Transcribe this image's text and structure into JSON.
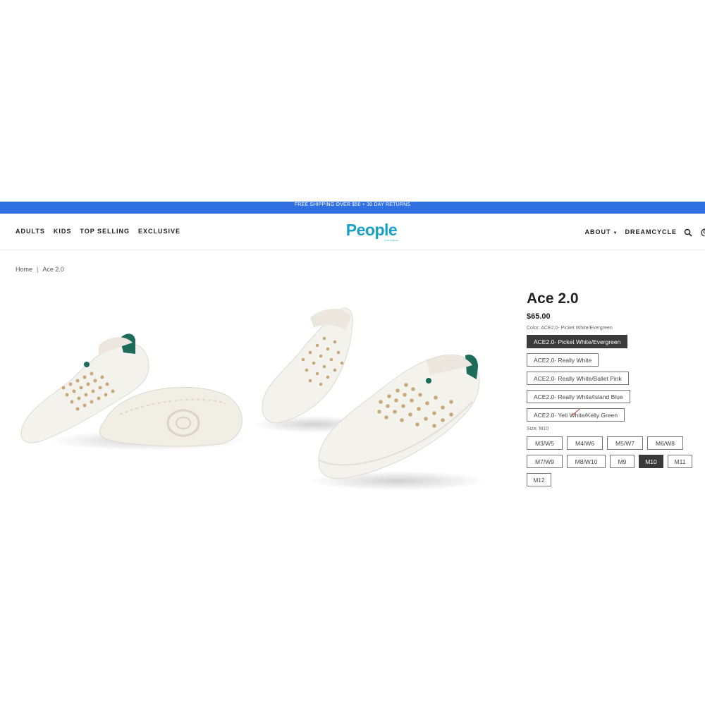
{
  "promo": "FREE SHIPPING OVER $50 + 30 DAY RETURNS",
  "nav": {
    "left": [
      "ADULTS",
      "KIDS",
      "TOP SELLING",
      "EXCLUSIVE"
    ],
    "right": [
      "ABOUT",
      "DREAMCYCLE"
    ]
  },
  "logo": {
    "word": "People",
    "sub": "FOOTWEAR"
  },
  "breadcrumb": {
    "home": "Home",
    "separator": "|",
    "current": "Ace 2.0"
  },
  "product": {
    "title": "Ace 2.0",
    "price": "$65.00",
    "color_label": "Color: ACE2.0- Picket White/Evergreen",
    "colors": [
      {
        "label": "ACE2.0- Picket White/Evergreen",
        "selected": true
      },
      {
        "label": "ACE2.0- Really White",
        "selected": false
      },
      {
        "label": "ACE2.0- Really White/Ballet Pink",
        "selected": false
      },
      {
        "label": "ACE2.0- Really White/Island Blue",
        "selected": false
      },
      {
        "label": "ACE2.0- Yeti White/Kelly Green",
        "selected": false
      }
    ],
    "size_label": "Size: M10",
    "sizes": [
      {
        "label": "M3/W5",
        "selected": false
      },
      {
        "label": "M4/W6",
        "selected": false
      },
      {
        "label": "M5/W7",
        "selected": false
      },
      {
        "label": "M6/W8",
        "selected": false
      },
      {
        "label": "M7/W9",
        "selected": false
      },
      {
        "label": "M8/W10",
        "selected": false
      },
      {
        "label": "M9",
        "selected": false
      },
      {
        "label": "M10",
        "selected": true
      },
      {
        "label": "M11",
        "selected": false
      },
      {
        "label": "M12",
        "selected": false
      }
    ]
  },
  "colors": {
    "promo_bar": "#2f6fe0",
    "logo": "#1aa0c8",
    "selected_option": "#3a3a3a",
    "heel_accent": "#1d6b5a"
  },
  "icons": [
    "search-icon",
    "account-icon",
    "caret-down-icon"
  ]
}
